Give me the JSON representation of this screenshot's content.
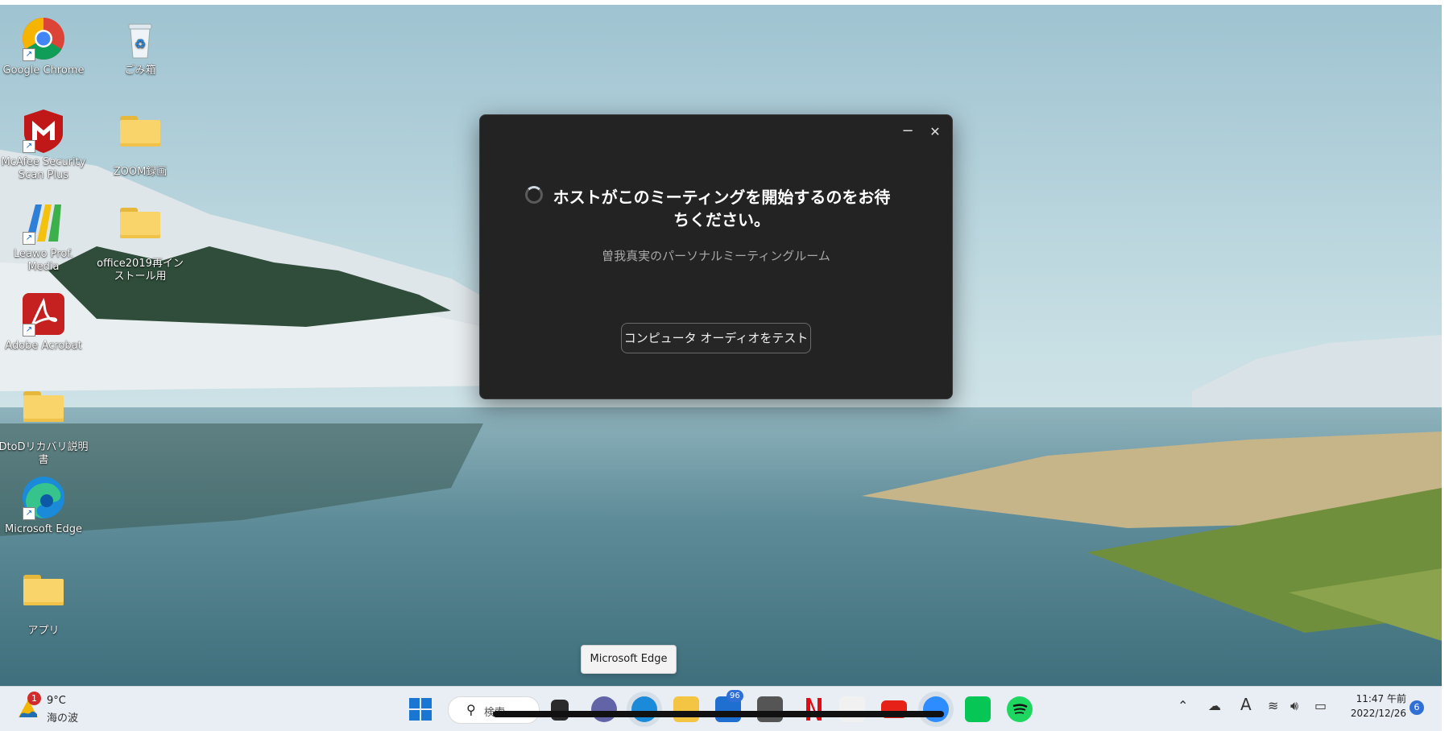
{
  "desktop": {
    "icons": [
      {
        "label": "Google Chrome"
      },
      {
        "label": "ごみ箱"
      },
      {
        "label": "McAfee Security Scan Plus"
      },
      {
        "label": "ZOOM録画"
      },
      {
        "label": "Leawo Prof. Media"
      },
      {
        "label": "office2019再インストール用"
      },
      {
        "label": "Adobe Acrobat"
      },
      {
        "label": "DtoDリカバリ説明書"
      },
      {
        "label": "Microsoft Edge"
      },
      {
        "label": "アプリ"
      }
    ]
  },
  "dialog": {
    "title": "ホストがこのミーティングを開始するのをお待ちください。",
    "subtitle": "曽我真実のパーソナルミーティングルーム",
    "audio_button": "コンピュータ オーディオをテスト",
    "minimize": "−",
    "close": "✕"
  },
  "tooltip": {
    "text": "Microsoft Edge"
  },
  "taskbar": {
    "weather": {
      "badge": "1",
      "temp": "9°C",
      "condition": "海の波"
    },
    "search_placeholder": "検索",
    "mail_badge": "96",
    "clock": {
      "time": "11:47 午前",
      "date": "2022/12/26"
    },
    "notifications": "6",
    "ime": "A"
  },
  "colors": {
    "dialog_bg": "#232323",
    "taskbar_bg": "#e8eef4",
    "accent": "#2f6fd6"
  }
}
